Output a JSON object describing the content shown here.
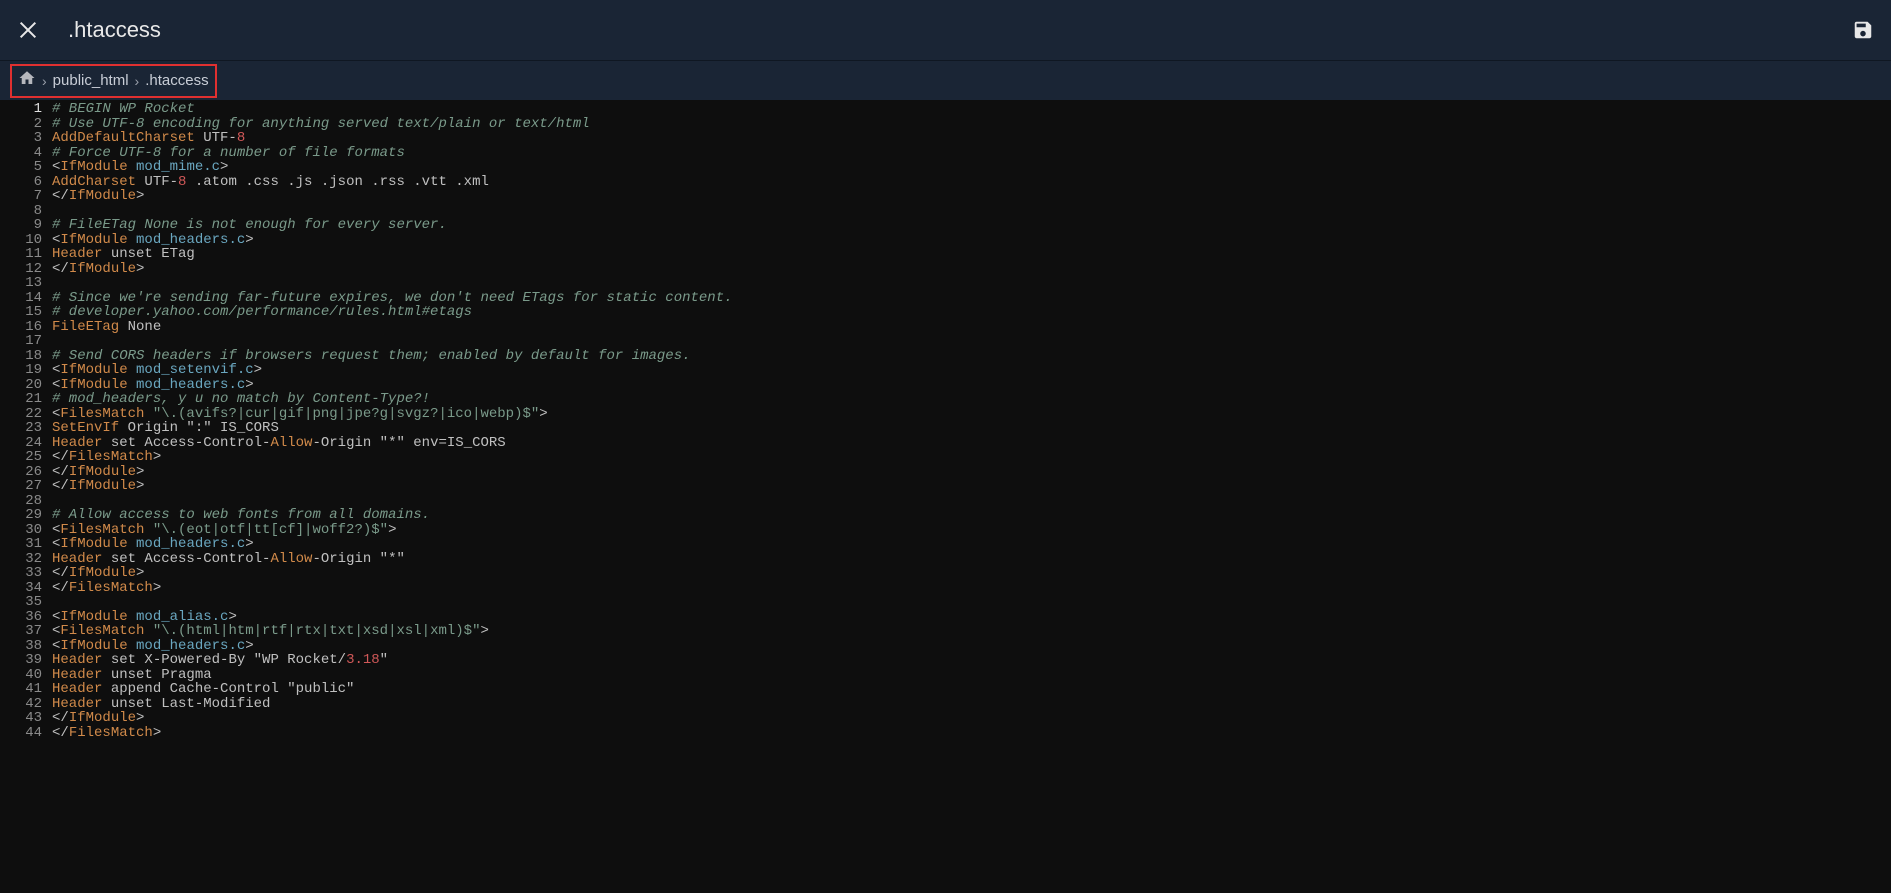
{
  "header": {
    "title": ".htaccess"
  },
  "breadcrumb": {
    "items": [
      "public_html",
      ".htaccess"
    ]
  },
  "editor": {
    "total_lines": 44,
    "lines": [
      {
        "tokens": [
          {
            "cls": "c",
            "t": "# BEGIN WP Rocket"
          }
        ]
      },
      {
        "tokens": [
          {
            "cls": "c",
            "t": "# Use UTF-8 encoding for anything served text/plain or text/html"
          }
        ]
      },
      {
        "tokens": [
          {
            "cls": "k",
            "t": "AddDefaultCharset"
          },
          {
            "cls": "txt",
            "t": " UTF-"
          },
          {
            "cls": "n",
            "t": "8"
          }
        ]
      },
      {
        "tokens": [
          {
            "cls": "c",
            "t": "# Force UTF-8 for a number of file formats"
          }
        ]
      },
      {
        "tokens": [
          {
            "cls": "punc",
            "t": "<"
          },
          {
            "cls": "k",
            "t": "IfModule"
          },
          {
            "cls": "txt",
            "t": " "
          },
          {
            "cls": "m",
            "t": "mod_mime.c"
          },
          {
            "cls": "punc",
            "t": ">"
          }
        ]
      },
      {
        "tokens": [
          {
            "cls": "k",
            "t": "AddCharset"
          },
          {
            "cls": "txt",
            "t": " UTF-"
          },
          {
            "cls": "n",
            "t": "8"
          },
          {
            "cls": "txt",
            "t": " .atom .css .js .json .rss .vtt .xml"
          }
        ]
      },
      {
        "tokens": [
          {
            "cls": "punc",
            "t": "</"
          },
          {
            "cls": "k",
            "t": "IfModule"
          },
          {
            "cls": "punc",
            "t": ">"
          }
        ]
      },
      {
        "tokens": []
      },
      {
        "tokens": [
          {
            "cls": "c",
            "t": "# FileETag None is not enough for every server."
          }
        ]
      },
      {
        "tokens": [
          {
            "cls": "punc",
            "t": "<"
          },
          {
            "cls": "k",
            "t": "IfModule"
          },
          {
            "cls": "txt",
            "t": " "
          },
          {
            "cls": "m",
            "t": "mod_headers.c"
          },
          {
            "cls": "punc",
            "t": ">"
          }
        ]
      },
      {
        "tokens": [
          {
            "cls": "k",
            "t": "Header"
          },
          {
            "cls": "txt",
            "t": " unset ETag"
          }
        ]
      },
      {
        "tokens": [
          {
            "cls": "punc",
            "t": "</"
          },
          {
            "cls": "k",
            "t": "IfModule"
          },
          {
            "cls": "punc",
            "t": ">"
          }
        ]
      },
      {
        "tokens": []
      },
      {
        "tokens": [
          {
            "cls": "c",
            "t": "# Since we're sending far-future expires, we don't need ETags for static content."
          }
        ]
      },
      {
        "tokens": [
          {
            "cls": "c",
            "t": "# developer.yahoo.com/performance/rules.html#etags"
          }
        ]
      },
      {
        "tokens": [
          {
            "cls": "k",
            "t": "FileETag"
          },
          {
            "cls": "txt",
            "t": " None"
          }
        ]
      },
      {
        "tokens": []
      },
      {
        "tokens": [
          {
            "cls": "c",
            "t": "# Send CORS headers if browsers request them; enabled by default for images."
          }
        ]
      },
      {
        "tokens": [
          {
            "cls": "punc",
            "t": "<"
          },
          {
            "cls": "k",
            "t": "IfModule"
          },
          {
            "cls": "txt",
            "t": " "
          },
          {
            "cls": "m",
            "t": "mod_setenvif.c"
          },
          {
            "cls": "punc",
            "t": ">"
          }
        ]
      },
      {
        "tokens": [
          {
            "cls": "punc",
            "t": "<"
          },
          {
            "cls": "k",
            "t": "IfModule"
          },
          {
            "cls": "txt",
            "t": " "
          },
          {
            "cls": "m",
            "t": "mod_headers.c"
          },
          {
            "cls": "punc",
            "t": ">"
          }
        ]
      },
      {
        "tokens": [
          {
            "cls": "c",
            "t": "# mod_headers, y u no match by Content-Type?!"
          }
        ]
      },
      {
        "tokens": [
          {
            "cls": "punc",
            "t": "<"
          },
          {
            "cls": "k",
            "t": "FilesMatch"
          },
          {
            "cls": "txt",
            "t": " "
          },
          {
            "cls": "s",
            "t": "\"\\.(avifs?|cur|gif|png|jpe?g|svgz?|ico|webp)$\""
          },
          {
            "cls": "punc",
            "t": ">"
          }
        ]
      },
      {
        "tokens": [
          {
            "cls": "k",
            "t": "SetEnvIf"
          },
          {
            "cls": "txt",
            "t": " Origin \":\" IS_CORS"
          }
        ]
      },
      {
        "tokens": [
          {
            "cls": "k",
            "t": "Header"
          },
          {
            "cls": "txt",
            "t": " set Access-Control-"
          },
          {
            "cls": "k",
            "t": "Allow"
          },
          {
            "cls": "txt",
            "t": "-Origin \"*\" env=IS_CORS"
          }
        ]
      },
      {
        "tokens": [
          {
            "cls": "punc",
            "t": "</"
          },
          {
            "cls": "k",
            "t": "FilesMatch"
          },
          {
            "cls": "punc",
            "t": ">"
          }
        ]
      },
      {
        "tokens": [
          {
            "cls": "punc",
            "t": "</"
          },
          {
            "cls": "k",
            "t": "IfModule"
          },
          {
            "cls": "punc",
            "t": ">"
          }
        ]
      },
      {
        "tokens": [
          {
            "cls": "punc",
            "t": "</"
          },
          {
            "cls": "k",
            "t": "IfModule"
          },
          {
            "cls": "punc",
            "t": ">"
          }
        ]
      },
      {
        "tokens": []
      },
      {
        "tokens": [
          {
            "cls": "c",
            "t": "# Allow access to web fonts from all domains."
          }
        ]
      },
      {
        "tokens": [
          {
            "cls": "punc",
            "t": "<"
          },
          {
            "cls": "k",
            "t": "FilesMatch"
          },
          {
            "cls": "txt",
            "t": " "
          },
          {
            "cls": "s",
            "t": "\"\\.(eot|otf|tt[cf]|woff2?)$\""
          },
          {
            "cls": "punc",
            "t": ">"
          }
        ]
      },
      {
        "tokens": [
          {
            "cls": "punc",
            "t": "<"
          },
          {
            "cls": "k",
            "t": "IfModule"
          },
          {
            "cls": "txt",
            "t": " "
          },
          {
            "cls": "m",
            "t": "mod_headers.c"
          },
          {
            "cls": "punc",
            "t": ">"
          }
        ]
      },
      {
        "tokens": [
          {
            "cls": "k",
            "t": "Header"
          },
          {
            "cls": "txt",
            "t": " set Access-Control-"
          },
          {
            "cls": "k",
            "t": "Allow"
          },
          {
            "cls": "txt",
            "t": "-Origin \"*\""
          }
        ]
      },
      {
        "tokens": [
          {
            "cls": "punc",
            "t": "</"
          },
          {
            "cls": "k",
            "t": "IfModule"
          },
          {
            "cls": "punc",
            "t": ">"
          }
        ]
      },
      {
        "tokens": [
          {
            "cls": "punc",
            "t": "</"
          },
          {
            "cls": "k",
            "t": "FilesMatch"
          },
          {
            "cls": "punc",
            "t": ">"
          }
        ]
      },
      {
        "tokens": []
      },
      {
        "tokens": [
          {
            "cls": "punc",
            "t": "<"
          },
          {
            "cls": "k",
            "t": "IfModule"
          },
          {
            "cls": "txt",
            "t": " "
          },
          {
            "cls": "m",
            "t": "mod_alias.c"
          },
          {
            "cls": "punc",
            "t": ">"
          }
        ]
      },
      {
        "tokens": [
          {
            "cls": "punc",
            "t": "<"
          },
          {
            "cls": "k",
            "t": "FilesMatch"
          },
          {
            "cls": "txt",
            "t": " "
          },
          {
            "cls": "s",
            "t": "\"\\.(html|htm|rtf|rtx|txt|xsd|xsl|xml)$\""
          },
          {
            "cls": "punc",
            "t": ">"
          }
        ]
      },
      {
        "tokens": [
          {
            "cls": "punc",
            "t": "<"
          },
          {
            "cls": "k",
            "t": "IfModule"
          },
          {
            "cls": "txt",
            "t": " "
          },
          {
            "cls": "m",
            "t": "mod_headers.c"
          },
          {
            "cls": "punc",
            "t": ">"
          }
        ]
      },
      {
        "tokens": [
          {
            "cls": "k",
            "t": "Header"
          },
          {
            "cls": "txt",
            "t": " set X-Powered-By \"WP Rocket/"
          },
          {
            "cls": "n",
            "t": "3.18"
          },
          {
            "cls": "txt",
            "t": "\""
          }
        ]
      },
      {
        "tokens": [
          {
            "cls": "k",
            "t": "Header"
          },
          {
            "cls": "txt",
            "t": " unset Pragma"
          }
        ]
      },
      {
        "tokens": [
          {
            "cls": "k",
            "t": "Header"
          },
          {
            "cls": "txt",
            "t": " append Cache-Control \"public\""
          }
        ]
      },
      {
        "tokens": [
          {
            "cls": "k",
            "t": "Header"
          },
          {
            "cls": "txt",
            "t": " unset Last-Modified"
          }
        ]
      },
      {
        "tokens": [
          {
            "cls": "punc",
            "t": "</"
          },
          {
            "cls": "k",
            "t": "IfModule"
          },
          {
            "cls": "punc",
            "t": ">"
          }
        ]
      },
      {
        "tokens": [
          {
            "cls": "punc",
            "t": "</"
          },
          {
            "cls": "k",
            "t": "FilesMatch"
          },
          {
            "cls": "punc",
            "t": ">"
          }
        ]
      }
    ]
  }
}
